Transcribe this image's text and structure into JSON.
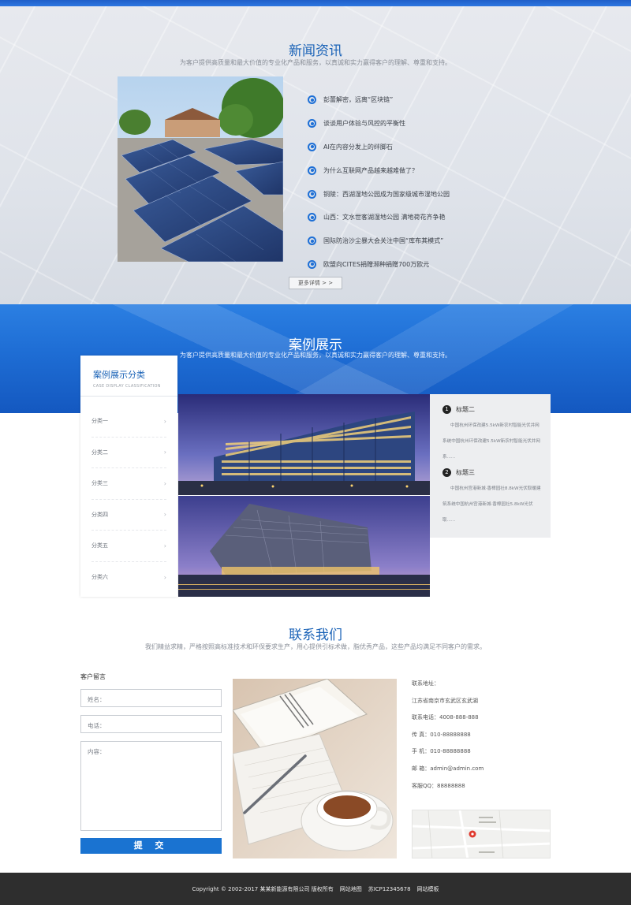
{
  "news": {
    "title": "新闻资讯",
    "subtitle": "为客户提供高质量和最大价值的专业化产品和服务，以真诚和实力赢得客户的理解、尊重和支持。",
    "items": [
      "彭蕾解密，远离“区块链”",
      "谈谈用户体验与风控的平衡性",
      "AI在内容分发上的绊脚石",
      "为什么互联网产品越来越难做了？",
      "铜陵：西湖湿地公园成为国家级城市湿地公园",
      "山西：文水世客湖湿地公园 满地荷花齐争艳",
      "国际防治沙尘暴大会关注中国“库布其模式”",
      "欧盟向CITES捐赠濒种捐赠700万欧元"
    ],
    "more_label": "更多详情 > >"
  },
  "cases": {
    "title": "案例展示",
    "subtitle": "为客户提供高质量和最大价值的专业化产品和服务，以真诚和实力赢得客户的理解、尊重和支持。",
    "category_title": "案例展示分类",
    "category_subtitle": "CASE DISPLAY CLASSIFICATION",
    "categories": [
      "分类一",
      "分类二",
      "分类三",
      "分类四",
      "分类五",
      "分类六"
    ],
    "items": [
      {
        "num": "1",
        "title": "标题二",
        "desc": "中国杭州环保改建5.5kW新农村智能光伏并网系统中国杭州环保改建5.5kW新农村智能光伏并网系......"
      },
      {
        "num": "2",
        "title": "标题三",
        "desc": "中国杭州宫港新城·香樟园社8.8kW光伏取暖建筑系统中国杭州宫港新城·香樟园社5.8kW光伏取......"
      }
    ]
  },
  "contact": {
    "title": "联系我们",
    "subtitle": "我们精益求精，严格按照高标准技术和环保要求生产，用心提供引标术做，脂优秀产品，这些产品均满足不同客户的需求。",
    "form_label": "客户留言",
    "name_placeholder": "姓名：",
    "phone_placeholder": "电话：",
    "content_placeholder": "内容：",
    "submit_label": "提 交",
    "info": [
      "联系地址：",
      "江苏省南京市玄武区玄武湖",
      "联系电话：4008-888-888",
      "传 真：010-88888888",
      "手 机：010-88888888",
      "邮 箱：admin@admin.com",
      "客服QQ：88888888"
    ]
  },
  "footer": {
    "copyright": "Copyright © 2002-2017 某某新能源有限公司 版权所有",
    "sitemap": "网站地图",
    "icp": "苏ICP12345678",
    "template": "网站模板"
  },
  "colors": {
    "accent": "#1b63b7",
    "button": "#1a73d1",
    "footer": "#2e2e2e"
  }
}
